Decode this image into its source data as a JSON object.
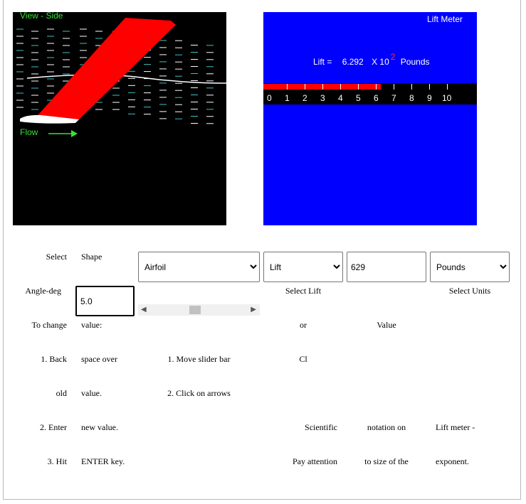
{
  "side_view": {
    "label": "View - Side",
    "flow_label": "Flow",
    "colors": {
      "airfoil": "#ff0000",
      "flow_lines": "#ffffff",
      "flow_alt": "#40c0c0",
      "label": "#35e335"
    }
  },
  "lift_meter": {
    "title": "Lift Meter",
    "lift_label": "Lift =",
    "lift_value": "6.292",
    "multiplier": "X 10",
    "exponent": "2",
    "units": "Pounds",
    "fill_fraction": 0.6292,
    "scale_labels": [
      "0",
      "1",
      "2",
      "3",
      "4",
      "5",
      "6",
      "7",
      "8",
      "9",
      "10"
    ]
  },
  "controls": {
    "select_label": "Select",
    "shape_label": "Shape",
    "shape_select": {
      "value": "Airfoil",
      "options": [
        "Airfoil"
      ]
    },
    "lift_select": {
      "value": "Lift",
      "options": [
        "Lift"
      ]
    },
    "lift_value_field": "629",
    "units_select": {
      "value": "Pounds",
      "options": [
        "Pounds"
      ]
    },
    "angle_label": "Angle-deg",
    "angle_value": "5.0",
    "select_lift_label": "Select Lift",
    "select_units_label": "Select Units",
    "angle_slider_fraction": 0.5
  },
  "instructions": {
    "row1": [
      "To change",
      "value:",
      "or",
      "Value"
    ],
    "row2": [
      "1. Back",
      "space over",
      "1. Move slider bar",
      "Cl"
    ],
    "row3": [
      "old",
      "value.",
      "2. Click on arrows"
    ],
    "row4": [
      "2. Enter",
      "new value.",
      "Scientific",
      "notation on",
      "Lift meter -"
    ],
    "row5": [
      "3. Hit",
      "ENTER key.",
      "Pay attention",
      "to size of the",
      "exponent."
    ]
  }
}
